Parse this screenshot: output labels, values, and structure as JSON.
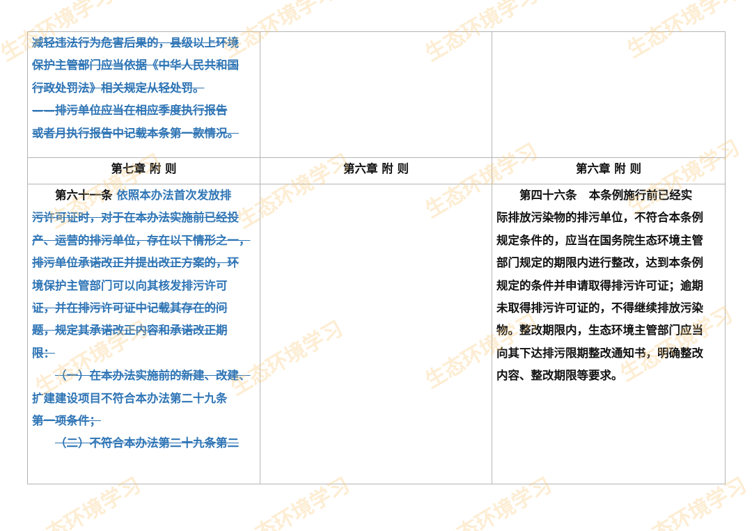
{
  "watermark": "生态环境学习",
  "top_row": {
    "col1_lines": [
      "减轻违法行为危害后果的，县级以上环境",
      "保护主管部门应当依据《中华人民共和国",
      "行政处罚法》相关规定从轻处罚。",
      "——排污单位应当在相应季度执行报告",
      "或者月执行报告中记载本条第一款情况。"
    ],
    "col2_text": "",
    "col3_text": ""
  },
  "heading_row": {
    "col1": "第七章  附  则",
    "col2": "第六章  附  则",
    "col3": "第六章  附  则"
  },
  "body_row": {
    "col1_article": "第六十一条",
    "col1_lead": "依照本办法首次发放排",
    "col1_lines": [
      "污许可证时，对于在本办法实施前已经投",
      "产、运营的排污单位，存在以下情形之一，",
      "排污单位承诺改正并提出改正方案的，环",
      "境保护主管部门可以向其核发排污许可",
      "证，并在排污许可证中记载其存在的问",
      "题，规定其承诺改正内容和承诺改正期",
      "限："
    ],
    "col1_item1_lines": [
      "（一）在本办法实施前的新建、改建、",
      "扩建建设项目不符合本办法第二十九条",
      "第一项条件；"
    ],
    "col1_item2_first": "（二）不符合本办法第二十九条第二",
    "col2_text": "",
    "col3_article": "第四十六条",
    "col3_lead": "本条例施行前已经实",
    "col3_lines": [
      "际排放污染物的排污单位，不符合本条例",
      "规定条件的，应当在国务院生态环境主管",
      "部门规定的期限内进行整改，达到本条例",
      "规定的条件并申请取得排污许可证；逾期",
      "未取得排污许可证的，不得继续排放污染",
      "物。整改期限内，生态环境主管部门应当",
      "向其下达排污限期整改通知书，明确整改",
      "内容、整改期限等要求。"
    ]
  },
  "colors": {
    "struck_text": "#2f75b5",
    "green_heading": "#22a84a",
    "body_text": "#111111",
    "border": "#b4b4b4",
    "watermark": "#fac878"
  }
}
